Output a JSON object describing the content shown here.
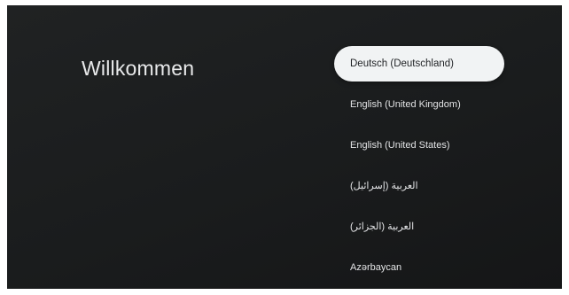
{
  "welcome": {
    "title": "Willkommen"
  },
  "languages": {
    "items": [
      {
        "label": "Deutsch (Deutschland)",
        "selected": true
      },
      {
        "label": "English (United Kingdom)",
        "selected": false
      },
      {
        "label": "English (United States)",
        "selected": false
      },
      {
        "label": "العربية (إسرائيل)",
        "selected": false
      },
      {
        "label": "العربية (الجزائر)",
        "selected": false
      },
      {
        "label": "Azərbaycan",
        "selected": false
      }
    ]
  },
  "colors": {
    "background": "#1c1e1f",
    "selected_pill": "#f1f3f4",
    "text": "#e3e4e6"
  }
}
